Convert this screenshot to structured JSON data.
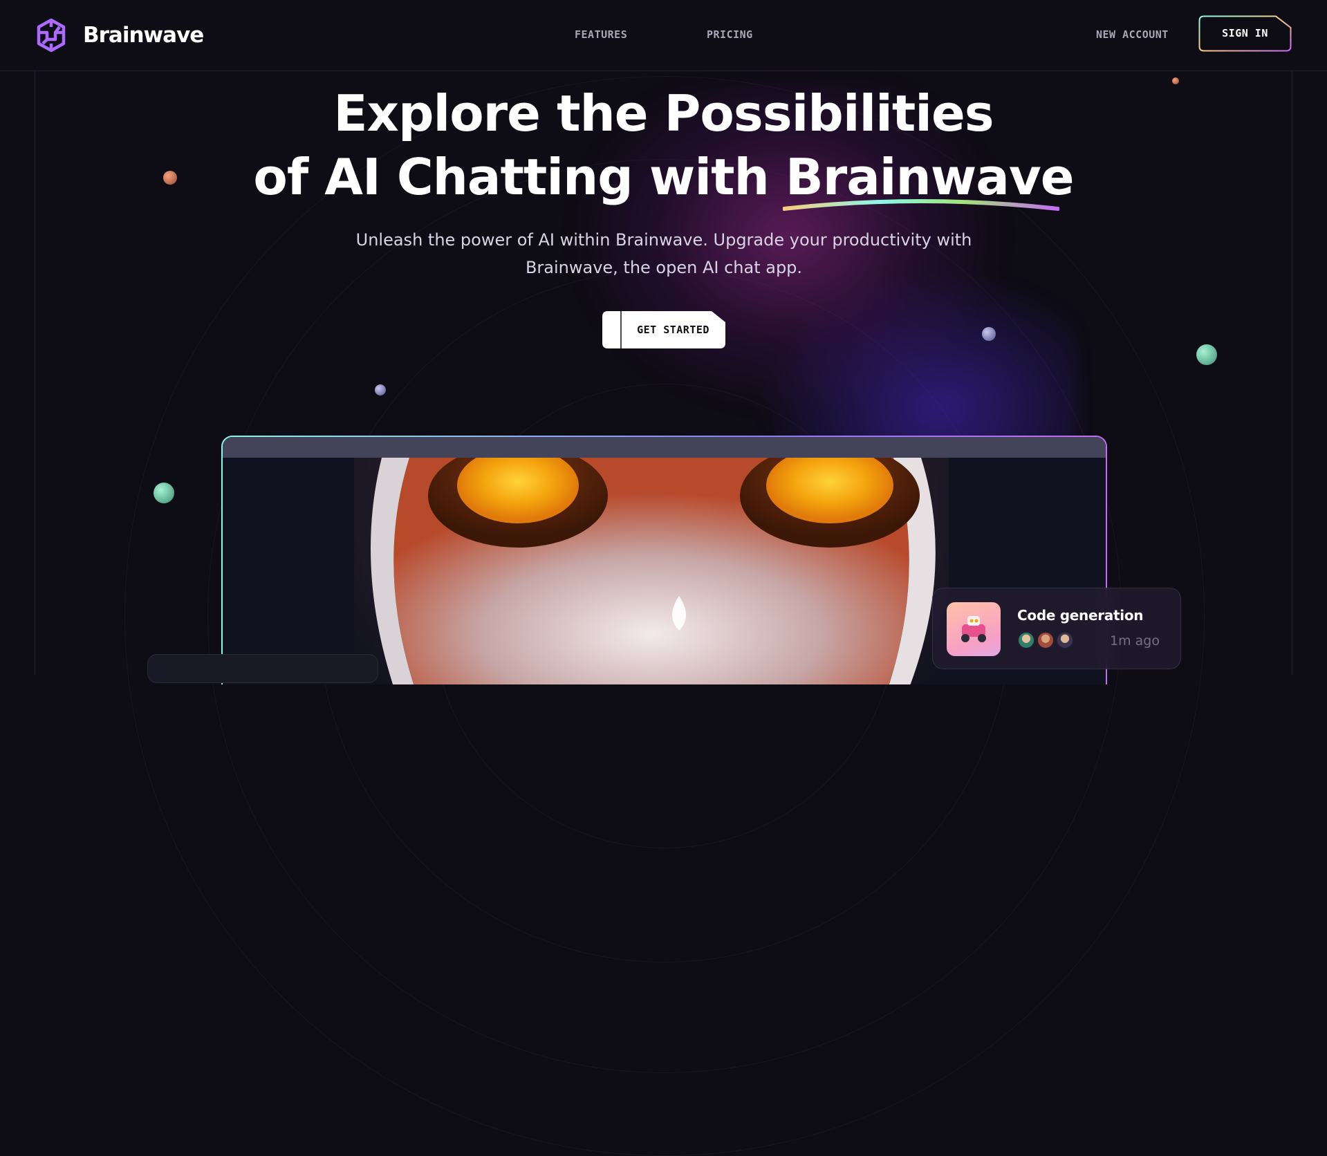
{
  "brand": {
    "name": "Brainwave",
    "logo_icon": "brain-knot-icon",
    "accent_color": "#ac6aff"
  },
  "nav": {
    "links": [
      "FEATURES",
      "PRICING"
    ],
    "new_account": "NEW ACCOUNT",
    "sign_in": "SIGN IN"
  },
  "hero": {
    "title_line1": "Explore the Possibilities",
    "title_line2_prefix": "of AI Chatting with ",
    "title_highlight": "Brainwave",
    "subtitle": "Unleash the power of AI within Brainwave. Upgrade your productivity with Brainwave, the open AI chat app.",
    "cta": "GET STARTED"
  },
  "notification": {
    "title": "Code generation",
    "time": "1m ago",
    "thumb_icon": "robot-toy-icon"
  },
  "colors": {
    "background": "#0e0c15",
    "stroke": "#252134",
    "gradient_start": "#89f9e8",
    "gradient_mid": "#facb7b",
    "gradient_end": "#c46bf2"
  }
}
